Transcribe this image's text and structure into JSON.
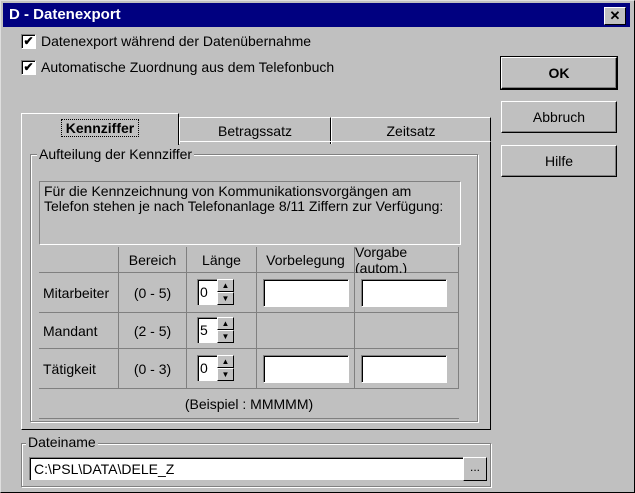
{
  "window": {
    "title": "D - Datenexport",
    "close": "✕"
  },
  "options": [
    {
      "label": "Datenexport während der Datenübernahme",
      "checked": true
    },
    {
      "label": "Automatische Zuordnung aus dem Telefonbuch",
      "checked": true
    }
  ],
  "buttons": {
    "ok": "OK",
    "cancel": "Abbruch",
    "help": "Hilfe"
  },
  "tabs": [
    "Kennziffer",
    "Betragssatz",
    "Zeitsatz"
  ],
  "group": {
    "legend": "Aufteilung der Kennziffer",
    "info": "Für die Kennzeichnung von Kommunikationsvorgängen am Telefon stehen je nach Telefonanlage 8/11 Ziffern zur Verfügung:",
    "columns": [
      "Bereich",
      "Länge",
      "Vorbelegung",
      "Vorgabe (autom.)"
    ],
    "rows": [
      {
        "label": "Mitarbeiter",
        "range": "(0 - 5)",
        "length": "0"
      },
      {
        "label": "Mandant",
        "range": "(2 - 5)",
        "length": "5"
      },
      {
        "label": "Tätigkeit",
        "range": "(0 - 3)",
        "length": "0"
      }
    ],
    "example": "(Beispiel : MMMMM)"
  },
  "file": {
    "legend": "Dateiname",
    "path": "C:\\PSL\\DATA\\DELE_Z",
    "browse": "..."
  }
}
